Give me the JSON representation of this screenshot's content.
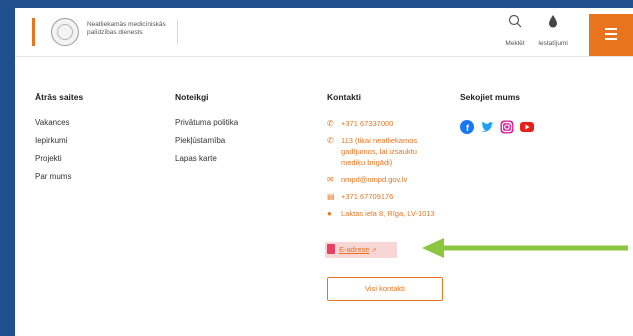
{
  "header": {
    "org_name": "Neatliekamās medicīniskās palīdzības dienests",
    "search_label": "Meklēt",
    "settings_label": "Iestatījumi"
  },
  "footer": {
    "quick_links": {
      "title": "Ātrās saites",
      "items": [
        "Vakances",
        "Iepirkumi",
        "Projekti",
        "Par mums"
      ]
    },
    "terms": {
      "title": "Noteikgi",
      "items": [
        "Privātuma politika",
        "Piekļūstamība",
        "Lapas karte"
      ]
    },
    "contacts": {
      "title": "Kontakti",
      "phone": "+371 67337000",
      "emergency": "113 (tikai neatliekamos gadījumos, lai izsauktu mediķu brigādi)",
      "email": "nmpd@nmpd.gov.lv",
      "fax": "+371 67709176",
      "address": "Laktas iela 8, Rīga, LV-1013",
      "eaddress": "E-adrese",
      "all_contacts": "Visi kontakti"
    },
    "follow": {
      "title": "Sekojiet mums",
      "networks": [
        "facebook-icon",
        "twitter-icon",
        "instagram-icon",
        "youtube-icon"
      ]
    }
  },
  "colors": {
    "accent": "#e8741e",
    "background": "#1f4f8c",
    "arrow": "#8cc63f"
  }
}
